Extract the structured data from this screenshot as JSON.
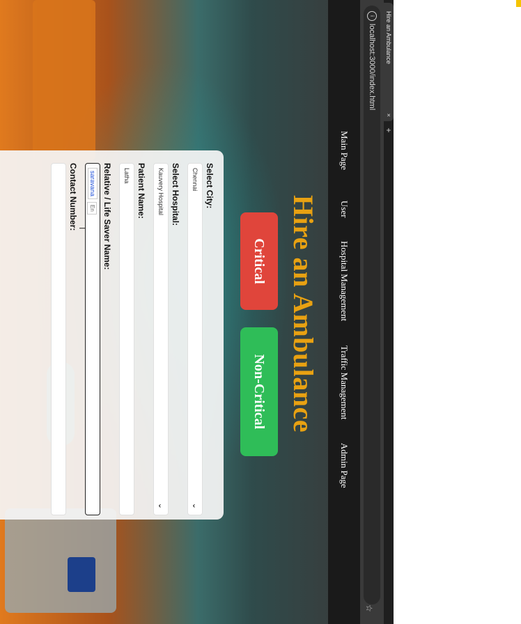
{
  "browser": {
    "tab_title": "Hire an Ambulance",
    "tab_close": "×",
    "new_tab": "+",
    "url": "localhost:3000/index.html"
  },
  "nav": {
    "items": [
      "Main Page",
      "User",
      "Hospital Management",
      "Traffic Management",
      "Admin Page"
    ]
  },
  "hero": {
    "title": "Hire an Ambulance",
    "critical_label": "Critical",
    "noncritical_label": "Non-Critical"
  },
  "form": {
    "city_label": "Select City:",
    "city_value": "Chennai",
    "hospital_label": "Select Hospital:",
    "hospital_value": "Kauvery Hospital",
    "patient_label": "Patient Name:",
    "patient_value": "Latha",
    "relative_label": "Relative / Life Saver Name:",
    "relative_chip": "saravana",
    "relative_chip2": "En",
    "contact_label": "Contact Number:",
    "contact_value": ""
  },
  "colors": {
    "accent_title": "#e8a112",
    "critical": "#e0453b",
    "noncritical": "#2fbd58",
    "navbar": "#1a1a1a"
  },
  "icons": {
    "info": "info-icon",
    "star": "star-icon",
    "chevron": "chevron-down-icon",
    "cursor": "text-cursor-icon"
  }
}
